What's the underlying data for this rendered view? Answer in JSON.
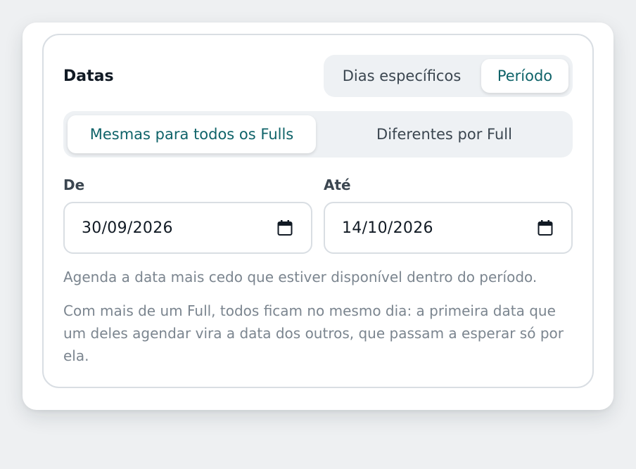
{
  "section": {
    "title": "Datas"
  },
  "date_type_toggle": {
    "options": [
      "Dias específicos",
      "Período"
    ],
    "selected": "Período"
  },
  "mode_toggle": {
    "options": [
      "Mesmas para todos os Fulls",
      "Diferentes por Full"
    ],
    "selected": "Mesmas para todos os Fulls"
  },
  "range": {
    "from_label": "De",
    "from_value": "30/09/2026",
    "to_label": "Até",
    "to_value": "14/10/2026"
  },
  "help": {
    "line1": "Agenda a data mais cedo que estiver disponível dentro do período.",
    "line2": "Com mais de um Full, todos ficam no mesmo dia: a primeira data que um deles agendar vira a data dos outros, que passam a esperar só por ela."
  },
  "colors": {
    "accent": "#0f6369",
    "toggle_bg": "#eef1f4",
    "border": "#d9dee3",
    "muted_text": "#7b858f"
  },
  "icons": {
    "date_picker": "calendar-icon"
  }
}
